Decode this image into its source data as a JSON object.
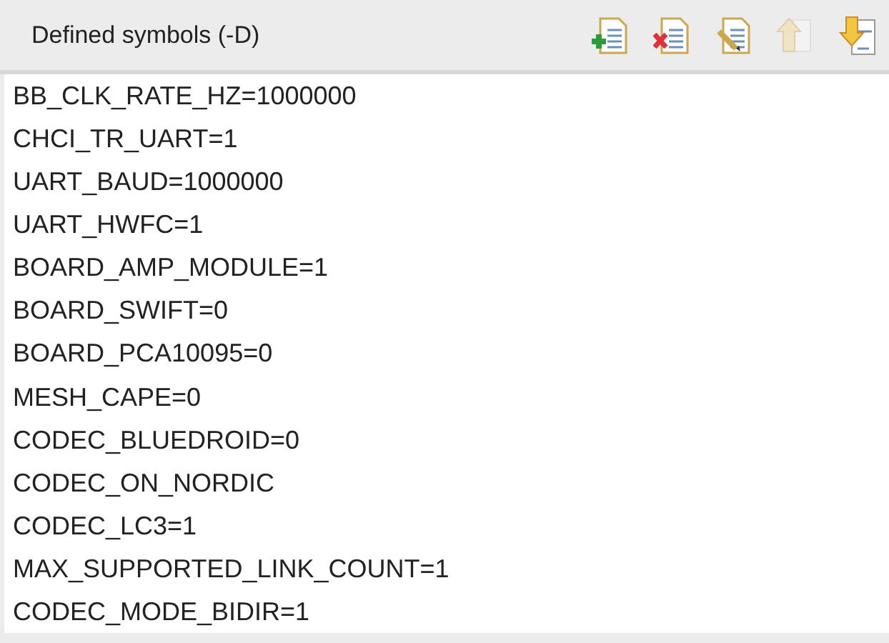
{
  "panel": {
    "title": "Defined symbols (-D)"
  },
  "toolbar": [
    {
      "kind": "add",
      "disabled": false
    },
    {
      "kind": "delete",
      "disabled": false
    },
    {
      "kind": "edit",
      "disabled": false
    },
    {
      "kind": "up",
      "disabled": true
    },
    {
      "kind": "down",
      "disabled": false
    }
  ],
  "symbols": [
    "BB_CLK_RATE_HZ=1000000",
    "CHCI_TR_UART=1",
    "UART_BAUD=1000000",
    "UART_HWFC=1",
    "BOARD_AMP_MODULE=1",
    "BOARD_SWIFT=0",
    "BOARD_PCA10095=0",
    "MESH_CAPE=0",
    "CODEC_BLUEDROID=0",
    "CODEC_ON_NORDIC",
    "CODEC_LC3=1",
    "MAX_SUPPORTED_LINK_COUNT=1",
    "CODEC_MODE_BIDIR=1"
  ]
}
